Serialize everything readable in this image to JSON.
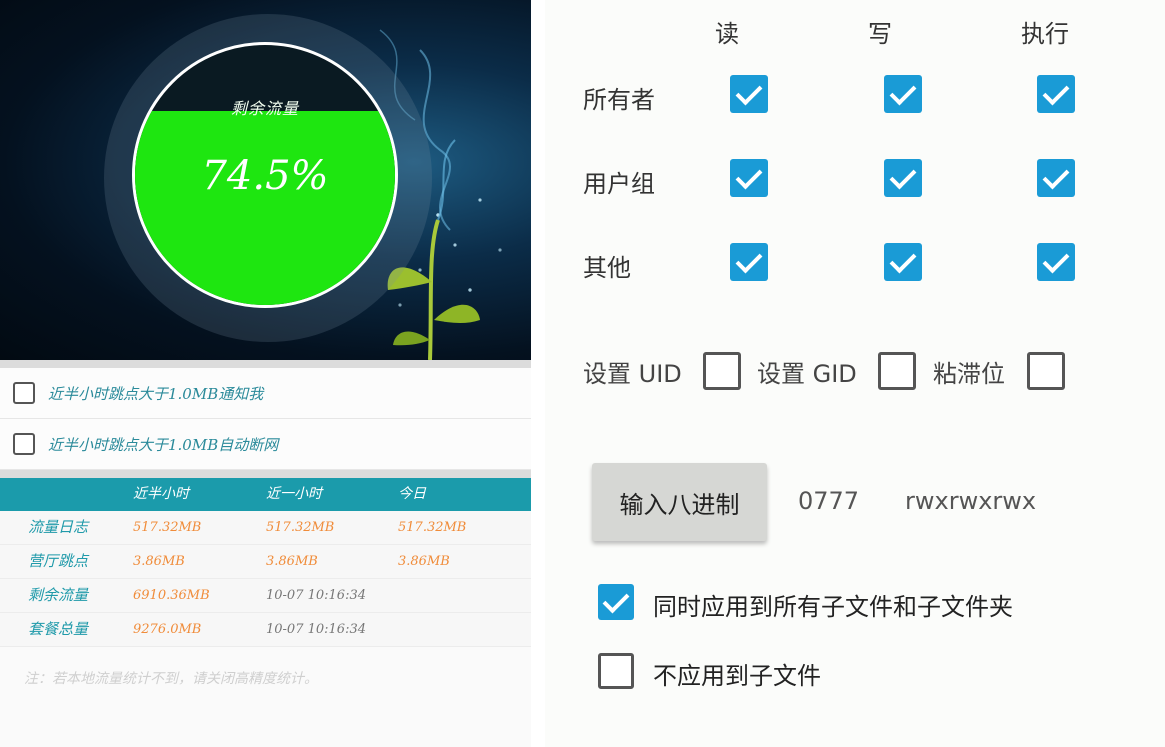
{
  "traffic_monitor": {
    "gauge": {
      "title": "剩余流量",
      "value_text": "74.5%",
      "fill_fraction": 0.745
    },
    "options": [
      {
        "label": "近半小时跳点大于1.0MB通知我",
        "checked": false
      },
      {
        "label": "近半小时跳点大于1.0MB自动断网",
        "checked": false
      }
    ],
    "table": {
      "headers": [
        "",
        "近半小时",
        "近一小时",
        "今日"
      ],
      "rows": [
        [
          "流量日志",
          "517.32MB",
          "517.32MB",
          "517.32MB"
        ],
        [
          "营厅跳点",
          "3.86MB",
          "3.86MB",
          "3.86MB"
        ],
        [
          "剩余流量",
          "6910.36MB",
          "10-07 10:16:34",
          ""
        ],
        [
          "套餐总量",
          "9276.0MB",
          "10-07 10:16:34",
          ""
        ]
      ]
    },
    "note": "注：若本地流量统计不到，请关闭高精度统计。"
  },
  "permissions": {
    "columns": [
      "读",
      "写",
      "执行"
    ],
    "rows": [
      {
        "label": "所有者",
        "values": [
          true,
          true,
          true
        ]
      },
      {
        "label": "用户组",
        "values": [
          true,
          true,
          true
        ]
      },
      {
        "label": "其他",
        "values": [
          true,
          true,
          true
        ]
      }
    ],
    "special": [
      {
        "label": "设置 UID",
        "checked": false
      },
      {
        "label": "设置 GID",
        "checked": false
      },
      {
        "label": "粘滞位",
        "checked": false
      }
    ],
    "octal_button_label": "输入八进制",
    "octal_value": "0777",
    "permission_string": "rwxrwxrwx",
    "apply_options": [
      {
        "label": "同时应用到所有子文件和子文件夹",
        "checked": true
      },
      {
        "label": "不应用到子文件",
        "checked": false
      }
    ],
    "accent_color": "#1a9bd6"
  }
}
